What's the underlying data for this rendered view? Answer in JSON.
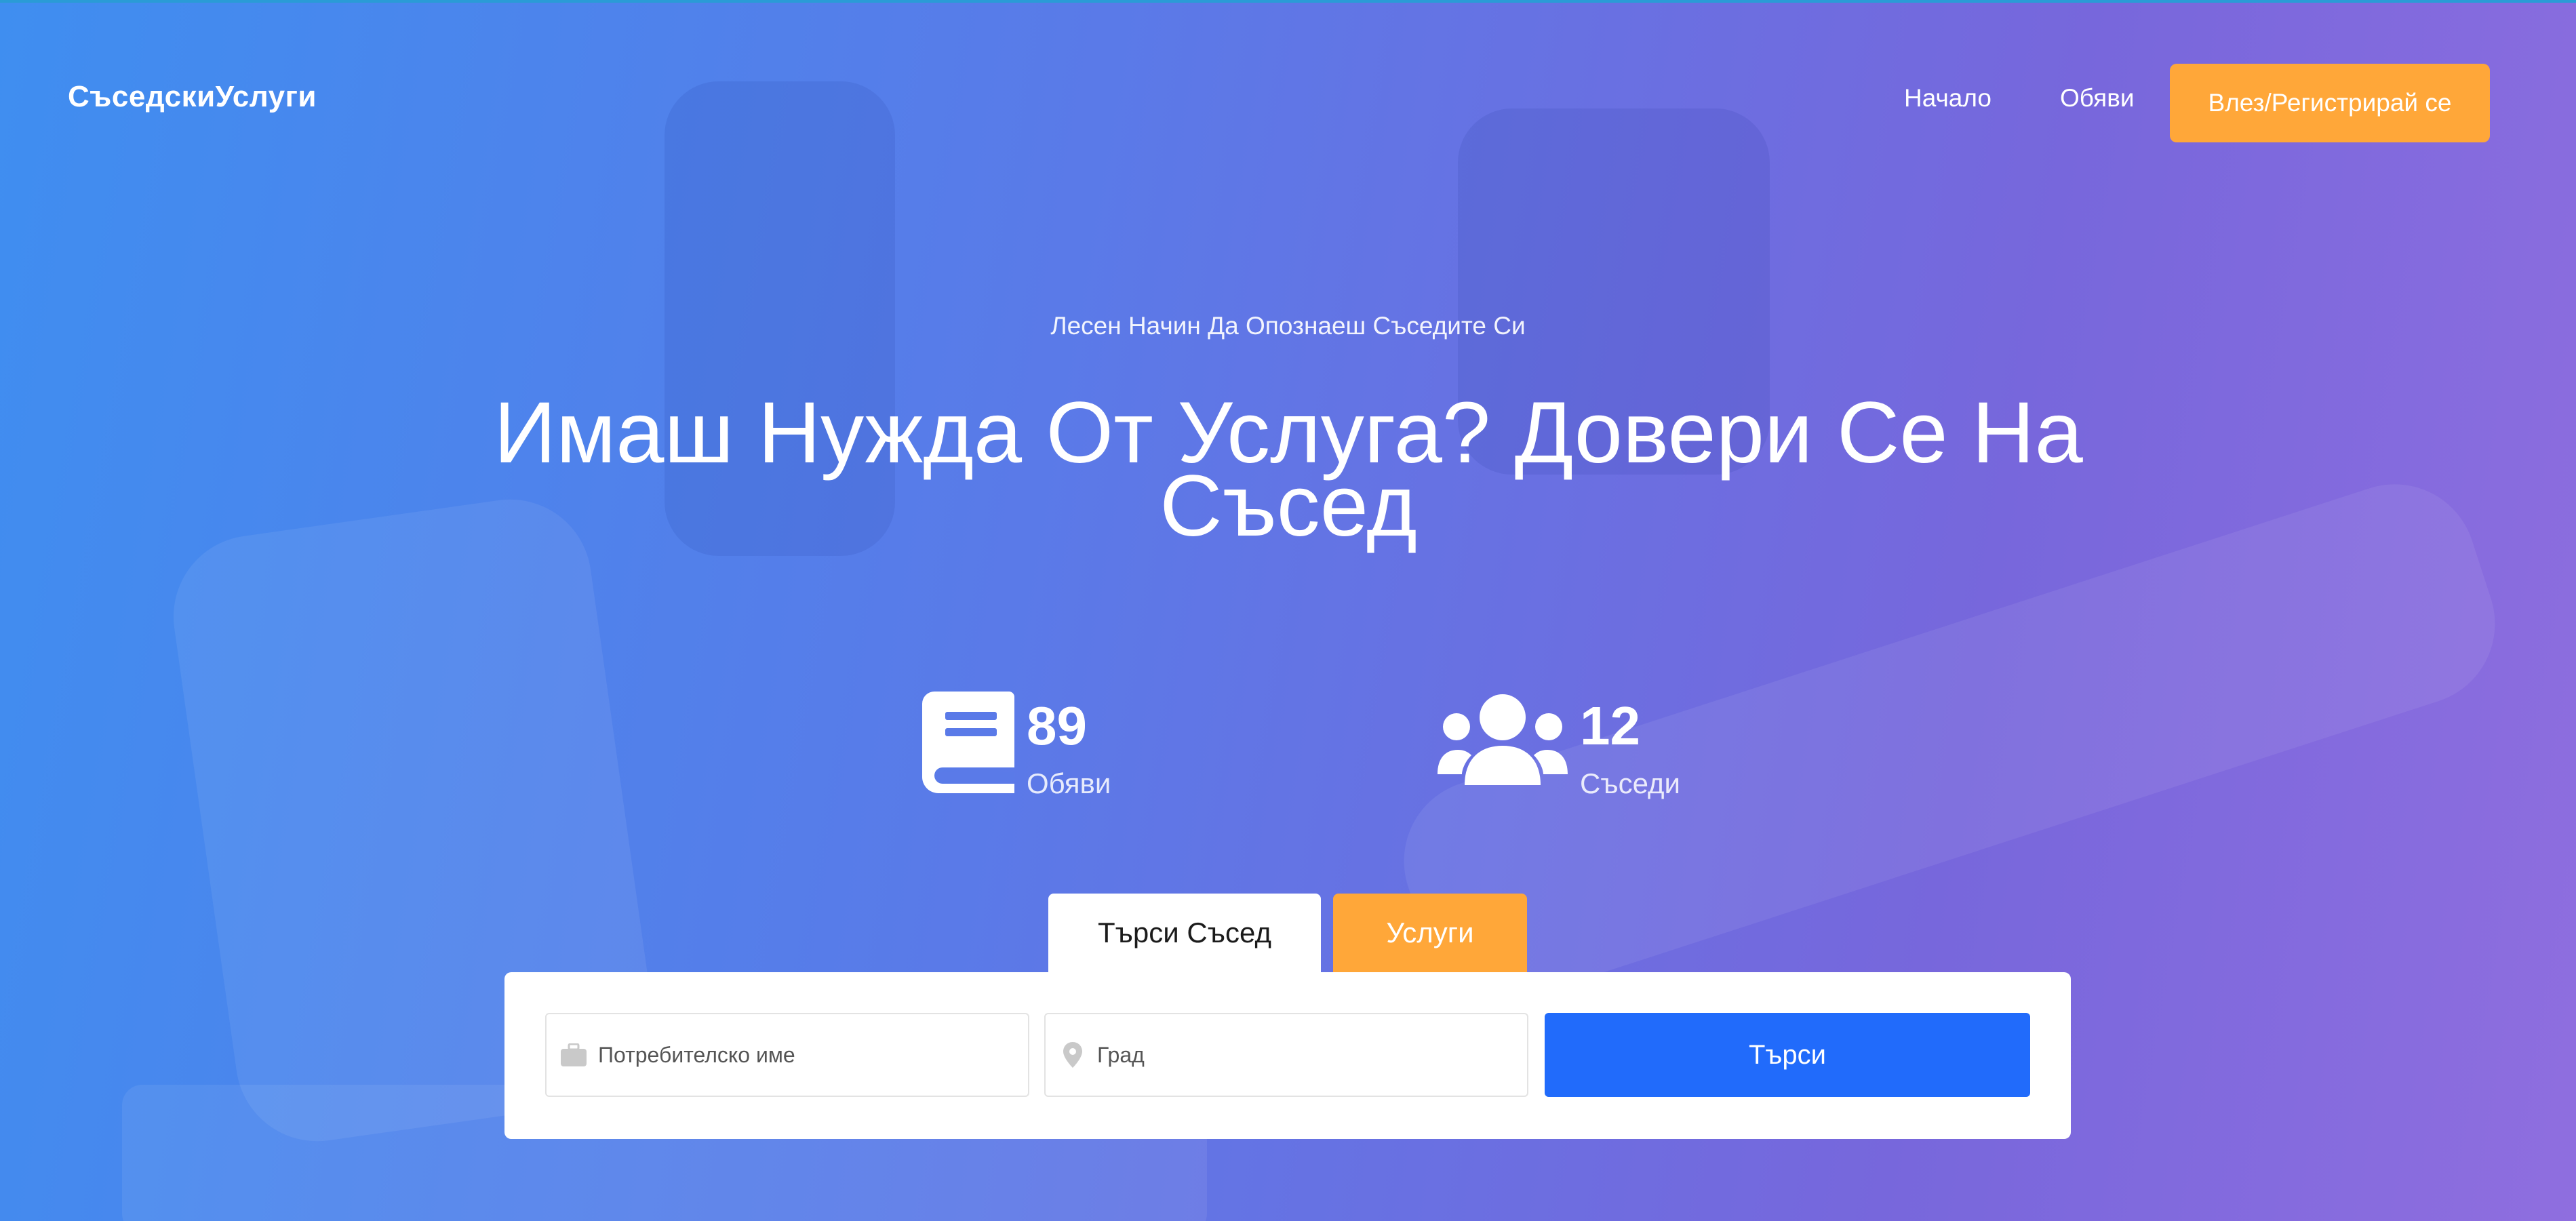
{
  "nav": {
    "brand": "СъседскиУслуги",
    "links": [
      {
        "label": "Начало"
      },
      {
        "label": "Обяви"
      }
    ],
    "login_label": "Влез/Регистрирай се"
  },
  "hero": {
    "subtitle": "Лесен Начин Да Опознаеш Съседите Си",
    "headline_line1": "Имаш Нужда От Услуга? Довери Се На",
    "headline_line2": "Съсед"
  },
  "stats": [
    {
      "icon": "book-icon",
      "value": "89",
      "label": "Обяви"
    },
    {
      "icon": "users-icon",
      "value": "12",
      "label": "Съседи"
    }
  ],
  "search": {
    "tabs": [
      {
        "label": "Търси Съсед",
        "active": true
      },
      {
        "label": "Услуги",
        "active": false
      }
    ],
    "username_placeholder": "Потребителско име",
    "city_placeholder": "Град",
    "search_label": "Търси"
  },
  "colors": {
    "accent_orange": "#ffa739",
    "search_blue": "#216bfb",
    "gradient_start": "#3f8ef0",
    "gradient_end": "#8f6edf"
  }
}
